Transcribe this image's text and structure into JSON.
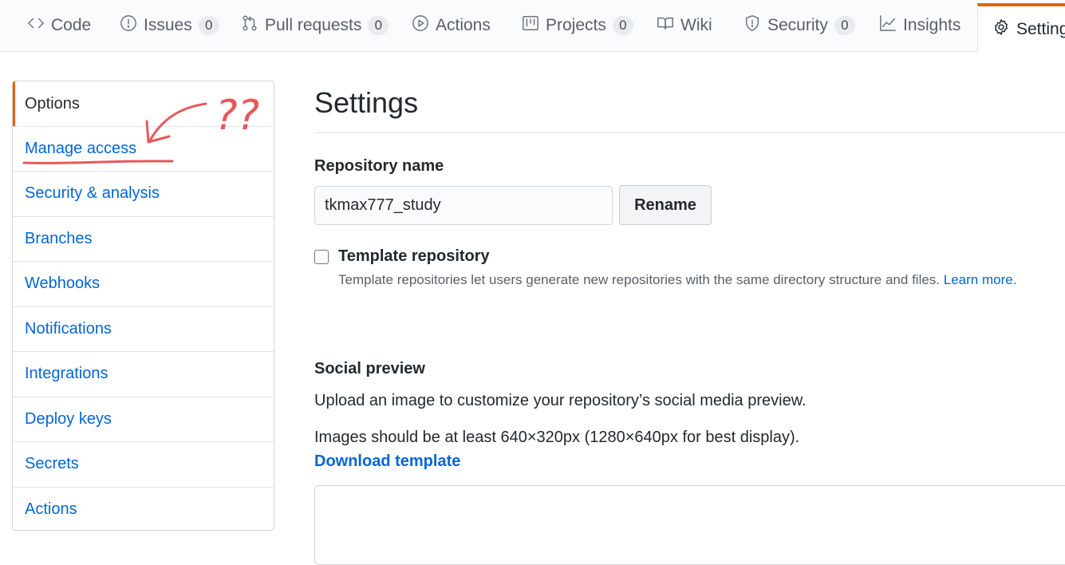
{
  "tabs": [
    {
      "label": "Code",
      "icon": "code-icon",
      "count": null
    },
    {
      "label": "Issues",
      "icon": "issue-icon",
      "count": "0"
    },
    {
      "label": "Pull requests",
      "icon": "pull-request-icon",
      "count": "0"
    },
    {
      "label": "Actions",
      "icon": "play-icon",
      "count": null
    },
    {
      "label": "Projects",
      "icon": "project-icon",
      "count": "0"
    },
    {
      "label": "Wiki",
      "icon": "book-icon",
      "count": null
    },
    {
      "label": "Security",
      "icon": "shield-icon",
      "count": "0"
    },
    {
      "label": "Insights",
      "icon": "graph-icon",
      "count": null
    },
    {
      "label": "Settings",
      "icon": "gear-icon",
      "count": null,
      "selected": true
    }
  ],
  "sidebar": {
    "items": [
      {
        "label": "Options"
      },
      {
        "label": "Manage access"
      },
      {
        "label": "Security & analysis"
      },
      {
        "label": "Branches"
      },
      {
        "label": "Webhooks"
      },
      {
        "label": "Notifications"
      },
      {
        "label": "Integrations"
      },
      {
        "label": "Deploy keys"
      },
      {
        "label": "Secrets"
      },
      {
        "label": "Actions"
      }
    ]
  },
  "main": {
    "title": "Settings",
    "repo_name_label": "Repository name",
    "repo_name_value": "tkmax777_study",
    "rename_label": "Rename",
    "template_label": "Template repository",
    "template_note": "Template repositories let users generate new repositories with the same directory structure and files.",
    "learn_more": "Learn more.",
    "social_title": "Social preview",
    "social_desc": "Upload an image to customize your repository’s social media preview.",
    "social_size": "Images should be at least 640×320px (1280×640px for best display).",
    "download_template": "Download template"
  },
  "annotation": {
    "text": "??"
  },
  "colors": {
    "accent": "#e36209",
    "link": "#0366d6",
    "annotation": "#e8585a"
  }
}
